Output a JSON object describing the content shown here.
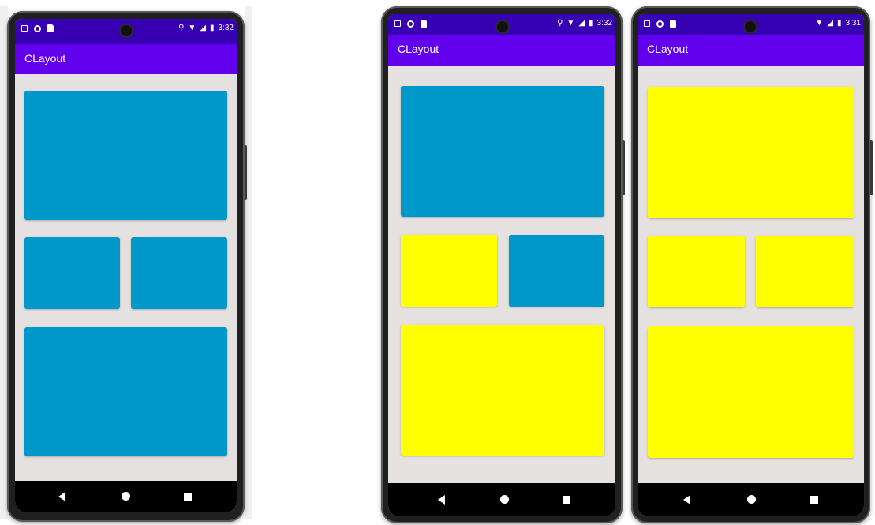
{
  "colors": {
    "status_bar": "#3700b3",
    "app_bar": "#6200ee",
    "background": "#e5e1e1",
    "blue": "#0098c8",
    "yellow": "#ffff00"
  },
  "phones": [
    {
      "status": {
        "time": "3:32",
        "icons": [
          "notification-a-icon",
          "circle-icon",
          "sd-card-icon",
          "location-icon",
          "wifi-icon",
          "signal-icon",
          "battery-icon"
        ]
      },
      "app_title": "CLayout",
      "boxes": {
        "top": "blue",
        "mid_left": "blue",
        "mid_right": "blue",
        "bottom": "blue"
      },
      "nav": [
        "back-button",
        "home-button",
        "recents-button"
      ]
    },
    {
      "status": {
        "time": "3:32",
        "icons": [
          "notification-a-icon",
          "circle-icon",
          "sd-card-icon",
          "location-icon",
          "wifi-icon",
          "signal-icon",
          "battery-icon"
        ]
      },
      "app_title": "CLayout",
      "boxes": {
        "top": "blue",
        "mid_left": "yellow",
        "mid_right": "blue",
        "bottom": "yellow"
      },
      "nav": [
        "back-button",
        "home-button",
        "recents-button"
      ]
    },
    {
      "status": {
        "time": "3:31",
        "icons": [
          "notification-a-icon",
          "circle-icon",
          "sd-card-icon",
          "wifi-icon",
          "signal-icon",
          "battery-icon"
        ]
      },
      "app_title": "CLayout",
      "boxes": {
        "top": "yellow",
        "mid_left": "yellow",
        "mid_right": "yellow",
        "bottom": "yellow"
      },
      "nav": [
        "back-button",
        "home-button",
        "recents-button"
      ]
    }
  ]
}
